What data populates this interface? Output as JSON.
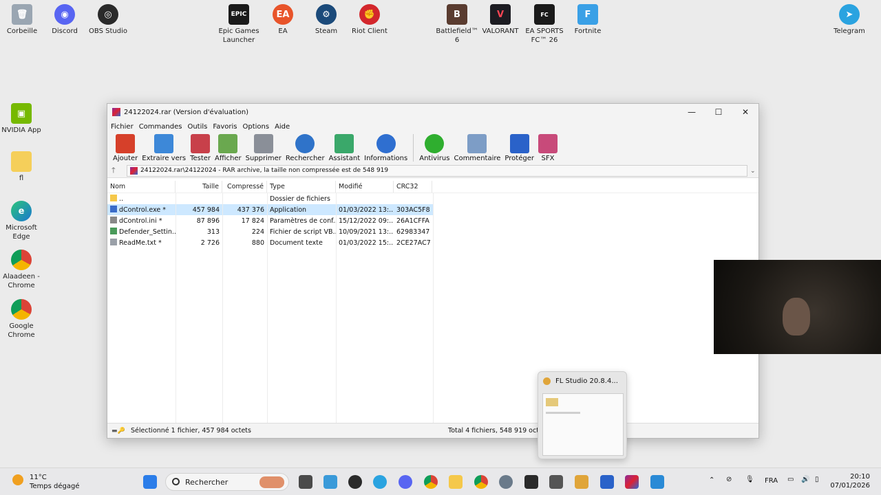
{
  "desktop": {
    "icons": [
      {
        "label": "Corbeille"
      },
      {
        "label": "Discord"
      },
      {
        "label": "OBS Studio"
      },
      {
        "label": "Epic Games Launcher"
      },
      {
        "label": "EA"
      },
      {
        "label": "Steam"
      },
      {
        "label": "Riot Client"
      },
      {
        "label": "Battlefield™ 6"
      },
      {
        "label": "VALORANT"
      },
      {
        "label": "EA SPORTS FC™ 26"
      },
      {
        "label": "Fortnite"
      },
      {
        "label": "Telegram"
      },
      {
        "label": "NVIDIA App"
      },
      {
        "label": "fl"
      },
      {
        "label": "Microsoft Edge"
      },
      {
        "label": "Alaadeen - Chrome"
      },
      {
        "label": "Google Chrome"
      }
    ]
  },
  "window": {
    "title": "24122024.rar (Version d'évaluation)",
    "controls": {
      "minimize": "—",
      "maximize": "☐",
      "close": "✕"
    },
    "menu": [
      "Fichier",
      "Commandes",
      "Outils",
      "Favoris",
      "Options",
      "Aide"
    ],
    "toolbar": [
      {
        "label": "Ajouter",
        "color": "#d6402a"
      },
      {
        "label": "Extraire vers",
        "color": "#3d88d8"
      },
      {
        "label": "Tester",
        "color": "#c8404a"
      },
      {
        "label": "Afficher",
        "color": "#6aa84f"
      },
      {
        "label": "Supprimer",
        "color": "#8a8f98"
      },
      {
        "label": "Rechercher",
        "color": "#2f73c9"
      },
      {
        "label": "Assistant",
        "color": "#3aa86a"
      },
      {
        "label": "Informations",
        "color": "#2f6fd0"
      },
      {
        "label": "Antivirus",
        "color": "#2fae2f"
      },
      {
        "label": "Commentaire",
        "color": "#7d9dc6"
      },
      {
        "label": "Protéger",
        "color": "#2a62c9"
      },
      {
        "label": "SFX",
        "color": "#c84a7a"
      }
    ],
    "path": "24122024.rar\\24122024 - RAR archive, la taille non compressée est de 548 919",
    "columns": [
      "Nom",
      "Taille",
      "Compressé",
      "Type",
      "Modifié",
      "CRC32"
    ],
    "parent_row": {
      "name": "..",
      "type": "Dossier de fichiers"
    },
    "files": [
      {
        "name": "dControl.exe *",
        "size": "457 984",
        "compressed": "437 376",
        "type": "Application",
        "modified": "01/03/2022 13:...",
        "crc": "303AC5F8",
        "color": "#3a6bc8"
      },
      {
        "name": "dControl.ini *",
        "size": "87 896",
        "compressed": "17 824",
        "type": "Paramètres de conf...",
        "modified": "15/12/2022 09:...",
        "crc": "26A1CFFA",
        "color": "#888888"
      },
      {
        "name": "Defender_Settin...",
        "size": "313",
        "compressed": "224",
        "type": "Fichier de script VB...",
        "modified": "10/09/2021 13:...",
        "crc": "62983347",
        "color": "#4a9a5a"
      },
      {
        "name": "ReadMe.txt *",
        "size": "2 726",
        "compressed": "880",
        "type": "Document texte",
        "modified": "01/03/2022 15:...",
        "crc": "2CE27AC7",
        "color": "#9aa0a8"
      }
    ],
    "status_left": "Sélectionné 1 fichier, 457 984 octets",
    "status_right": "Total 4 fichiers, 548 919 octets"
  },
  "thumbnail": {
    "title": "FL Studio 20.8.4..."
  },
  "taskbar": {
    "weather_temp": "11°C",
    "weather_text": "Temps dégagé",
    "search_placeholder": "Rechercher",
    "language": "FRA",
    "time": "20:10",
    "date": "07/01/2026"
  }
}
